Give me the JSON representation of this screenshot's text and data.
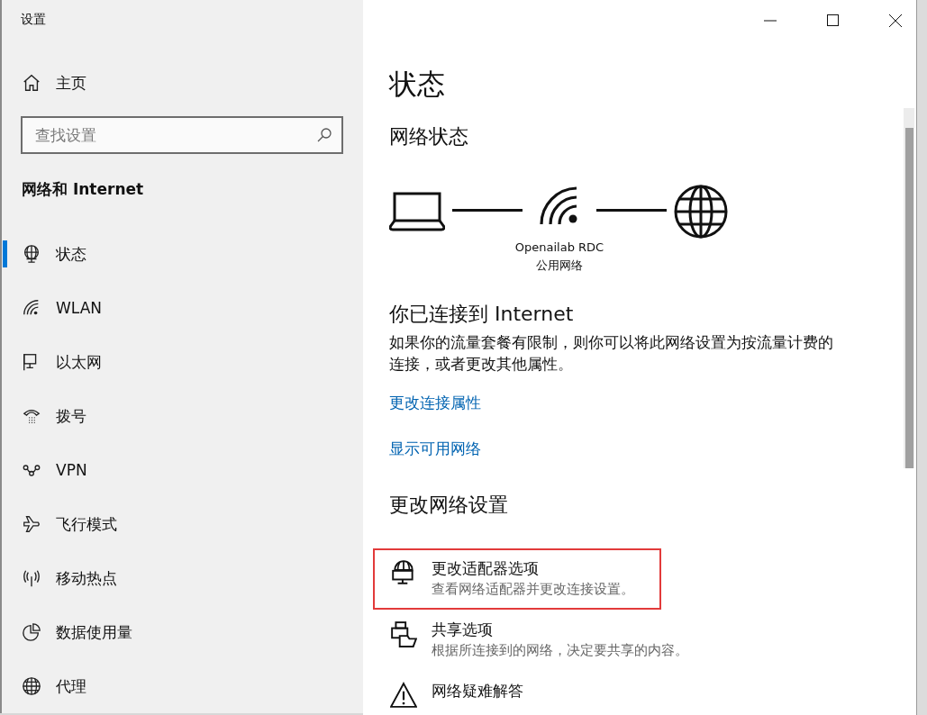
{
  "window": {
    "title": "设置"
  },
  "sidebar": {
    "home": "主页",
    "search": {
      "placeholder": "查找设置"
    },
    "section": "网络和 Internet",
    "items": [
      {
        "label": "状态",
        "kind": "status",
        "selected": true
      },
      {
        "label": "WLAN",
        "kind": "wifi",
        "selected": false
      },
      {
        "label": "以太网",
        "kind": "ethernet",
        "selected": false
      },
      {
        "label": "拨号",
        "kind": "dialup",
        "selected": false
      },
      {
        "label": "VPN",
        "kind": "vpn",
        "selected": false
      },
      {
        "label": "飞行模式",
        "kind": "airplane",
        "selected": false
      },
      {
        "label": "移动热点",
        "kind": "hotspot",
        "selected": false
      },
      {
        "label": "数据使用量",
        "kind": "pie",
        "selected": false
      },
      {
        "label": "代理",
        "kind": "globe",
        "selected": false
      }
    ]
  },
  "main": {
    "title": "状态",
    "network_status": {
      "heading": "网络状态",
      "network_name": "Openailab RDC",
      "network_type": "公用网络"
    },
    "connection": {
      "heading": "你已连接到 Internet",
      "description": "如果你的流量套餐有限制，则你可以将此网络设置为按流量计费的连接，或者更改其他属性。",
      "links": [
        "更改连接属性",
        "显示可用网络"
      ]
    },
    "change_settings": {
      "heading": "更改网络设置",
      "options": [
        {
          "kind": "adapter",
          "title": "更改适配器选项",
          "description": "查看网络适配器并更改连接设置。",
          "highlighted": true
        },
        {
          "kind": "sharing",
          "title": "共享选项",
          "description": "根据所连接到的网络，决定要共享的内容。",
          "highlighted": false
        },
        {
          "kind": "warning",
          "title": "网络疑难解答",
          "highlighted": false
        }
      ]
    }
  }
}
